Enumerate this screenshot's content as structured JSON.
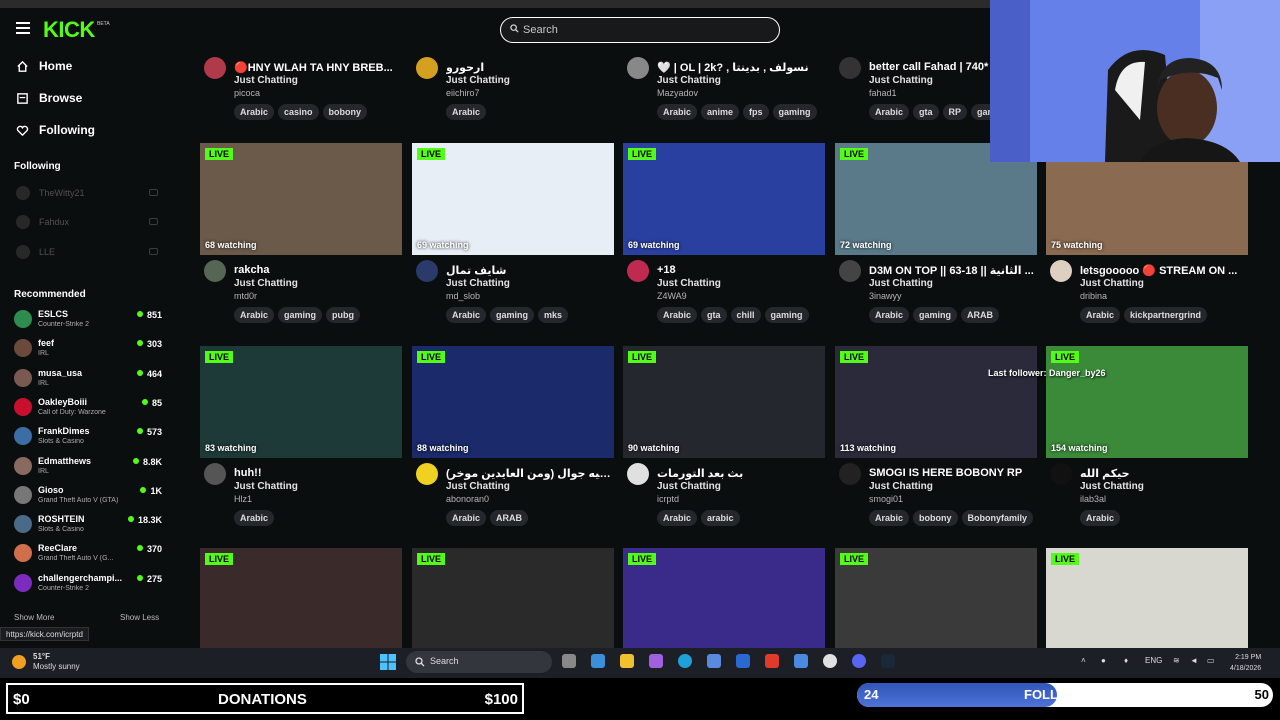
{
  "app": {
    "logo": "KICK",
    "beta": "BETA"
  },
  "search": {
    "placeholder": "Search"
  },
  "sidebar": {
    "nav": [
      {
        "label": "Home"
      },
      {
        "label": "Browse"
      },
      {
        "label": "Following"
      }
    ],
    "following_heading": "Following",
    "following": [
      {
        "name": "TheWitty21"
      },
      {
        "name": "Fahdux"
      },
      {
        "name": "LLE"
      }
    ],
    "recommended_heading": "Recommended",
    "recommended": [
      {
        "name": "ESLCS",
        "category": "Counter-Strike 2",
        "viewers": "851",
        "color": "#2d8c4e"
      },
      {
        "name": "feef",
        "category": "IRL",
        "viewers": "303",
        "color": "#6a4a3a"
      },
      {
        "name": "musa_usa",
        "category": "IRL",
        "viewers": "464",
        "color": "#7a5a50"
      },
      {
        "name": "OakleyBoiii",
        "category": "Call of Duty: Warzone",
        "viewers": "85",
        "color": "#c8102e"
      },
      {
        "name": "FrankDimes",
        "category": "Slots & Casino",
        "viewers": "573",
        "color": "#3a6ea5"
      },
      {
        "name": "Edmatthews",
        "category": "IRL",
        "viewers": "8.8K",
        "color": "#8a6a60"
      },
      {
        "name": "Gioso",
        "category": "Grand Theft Auto V (GTA)",
        "viewers": "1K",
        "color": "#777777"
      },
      {
        "name": "ROSHTEIN",
        "category": "Slots & Casino",
        "viewers": "18.3K",
        "color": "#4a6a8a"
      },
      {
        "name": "ReeClare",
        "category": "Grand Theft Auto V (G...",
        "viewers": "370",
        "color": "#d0704a"
      },
      {
        "name": "challengerchampi...",
        "category": "Counter-Strike 2",
        "viewers": "275",
        "color": "#7b2cbf"
      }
    ],
    "show_more": "Show More",
    "show_less": "Show Less"
  },
  "hover_url": "https://kick.com/icrptd",
  "cards": [
    {
      "title": "🔴HNY WLAH TA HNY BREB...",
      "category": "Just Chatting",
      "user": "picoca",
      "tags": [
        "Arabic",
        "casino",
        "bobony"
      ],
      "avatar": "#b03a4a"
    },
    {
      "title": "ارحورو",
      "category": "Just Chatting",
      "user": "eiichiro7",
      "tags": [
        "Arabic"
      ],
      "avatar": "#d4a020"
    },
    {
      "title": "🤍 | OL | 2k? , نسولف , بدينتا",
      "category": "Just Chatting",
      "user": "Mazyadov",
      "tags": [
        "Arabic",
        "anime",
        "fps",
        "gaming"
      ],
      "avatar": "#888888"
    },
    {
      "title": "better call Fahad | 740*",
      "category": "Just Chatting",
      "user": "fahad1",
      "tags": [
        "Arabic",
        "gta",
        "RP",
        "gami"
      ],
      "avatar": "#333333"
    },
    {
      "title": "rakcha",
      "category": "Just Chatting",
      "user": "mtd0r",
      "tags": [
        "Arabic",
        "gaming",
        "pubg"
      ],
      "avatar": "#556655",
      "watching": "68 watching",
      "thumb": "#6b5a4a"
    },
    {
      "title": "شايف تمال",
      "category": "Just Chatting",
      "user": "md_slob",
      "tags": [
        "Arabic",
        "gaming",
        "mks"
      ],
      "avatar": "#2a3a6a",
      "watching": "69 watching",
      "thumb": "#e8eef5"
    },
    {
      "title": "+18",
      "category": "Just Chatting",
      "user": "Z4WA9",
      "tags": [
        "Arabic",
        "gta",
        "chill",
        "gaming"
      ],
      "avatar": "#c02a50",
      "watching": "69 watching",
      "thumb": "#2a40a0"
    },
    {
      "title": "D3M ON TOP || 63-18 || الثانية ...",
      "category": "Just Chatting",
      "user": "3inawyy",
      "tags": [
        "Arabic",
        "gaming",
        "ARAB"
      ],
      "avatar": "#444444",
      "watching": "72 watching",
      "thumb": "#5a7a8a"
    },
    {
      "title": "letsgooooo 🔴 STREAM ON ...",
      "category": "Just Chatting",
      "user": "dribina",
      "tags": [
        "Arabic",
        "kickpartnergrind"
      ],
      "avatar": "#ddd0c0",
      "watching": "75 watching",
      "thumb": "#8a6a50"
    },
    {
      "title": "huh!!",
      "category": "Just Chatting",
      "user": "Hlz1",
      "tags": [
        "Arabic"
      ],
      "avatar": "#555555",
      "watching": "83 watching",
      "thumb": "#1e3a38"
    },
    {
      "title": "افضل خلقيه جوال (ومن العايدين موخر) ...",
      "category": "Just Chatting",
      "user": "abonoran0",
      "tags": [
        "Arabic",
        "ARAB"
      ],
      "avatar": "#f0d020",
      "watching": "88 watching",
      "thumb": "#1a2a6a"
    },
    {
      "title": "بث بعد التورمات",
      "category": "Just Chatting",
      "user": "icrptd",
      "tags": [
        "Arabic",
        "arabic"
      ],
      "avatar": "#e0e0e0",
      "watching": "90 watching",
      "thumb": "#24272e"
    },
    {
      "title": "SMOGI IS HERE BOBONY RP",
      "category": "Just Chatting",
      "user": "smogi01",
      "tags": [
        "Arabic",
        "bobony",
        "Bobonyfamily"
      ],
      "avatar": "#222222",
      "watching": "113 watching",
      "thumb": "#2a2a3a"
    },
    {
      "title": "حيكم الله",
      "category": "Just Chatting",
      "user": "ilab3al",
      "tags": [
        "Arabic"
      ],
      "avatar": "#111111",
      "watching": "154 watching",
      "thumb": "#3a8a3a"
    },
    {
      "thumb": "#3a2a2a"
    },
    {
      "thumb": "#2a2a2a"
    },
    {
      "thumb": "#3a2a8a"
    },
    {
      "thumb": "#3a3a3a"
    },
    {
      "thumb": "#d8d8d0"
    }
  ],
  "live_label": "LIVE",
  "follower_alert": "Last follower: Danger_by26",
  "taskbar": {
    "temp": "51°F",
    "condition": "Mostly sunny",
    "search": "Search",
    "lang": "ENG",
    "time": "2:19 PM",
    "date": "4/18/2026"
  },
  "overlay": {
    "donation_current": "$0",
    "donations_label": "DONATIONS",
    "donation_goal": "$100",
    "followers_current": "24",
    "followers_label": "FOLLOWERS",
    "followers_goal": "50",
    "followers_progress": 0.48
  },
  "colors": {
    "accent": "#53fc18",
    "background": "#0b0e0f",
    "tag": "#24272c"
  }
}
